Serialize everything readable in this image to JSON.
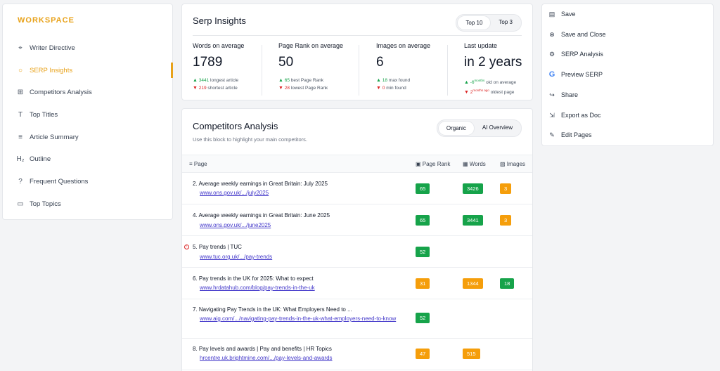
{
  "sidebar": {
    "title": "WORKSPACE",
    "items": [
      {
        "label": "Writer Directive",
        "icon": "⌖"
      },
      {
        "label": "SERP Insights",
        "icon": "💡"
      },
      {
        "label": "Competitors Analysis",
        "icon": "⊞"
      },
      {
        "label": "Top Titles",
        "icon": "T"
      },
      {
        "label": "Article Summary",
        "icon": "≡"
      },
      {
        "label": "Outline",
        "icon": "H₂"
      },
      {
        "label": "Frequent Questions",
        "icon": "?"
      },
      {
        "label": "Top Topics",
        "icon": "▭"
      }
    ]
  },
  "serp": {
    "title": "Serp Insights",
    "toggle": [
      "Top 10",
      "Top 3"
    ],
    "stats": [
      {
        "label": "Words on average",
        "value": "1789",
        "up_num": "3441",
        "up_text": "longest article",
        "down_num": "219",
        "down_text": "shortest article"
      },
      {
        "label": "Page Rank on average",
        "value": "50",
        "up_num": "65",
        "up_text": "best Page Rank",
        "down_num": "28",
        "down_text": "lowest Page Rank"
      },
      {
        "label": "Images on average",
        "value": "6",
        "up_num": "18",
        "up_text": "max found",
        "down_num": "0",
        "down_text": "min found"
      },
      {
        "label": "Last update",
        "value": "in 2 years",
        "up_num": "-6",
        "up_unit": "months",
        "up_text": "old on average",
        "down_num": "2",
        "down_unit": "months ago",
        "down_text": "oldest page"
      }
    ]
  },
  "competitors": {
    "title": "Competitors Analysis",
    "description": "Use this block to highlight your main competitors.",
    "toggle": [
      "Organic",
      "AI Overview"
    ],
    "columns": [
      "Page",
      "Page Rank",
      "Words",
      "Images"
    ],
    "rows": [
      {
        "title": "2.  Average weekly earnings in Great Britain: July 2025",
        "url": "www.ons.gov.uk/.../july2025",
        "rank": "65",
        "words": "3426",
        "images": "3"
      },
      {
        "title": "4.  Average weekly earnings in Great Britain: June 2025",
        "url": "www.ons.gov.uk/.../june2025",
        "rank": "65",
        "words": "3441",
        "images": "3"
      },
      {
        "title": "5.  Pay trends | TUC",
        "url": "www.tuc.org.uk/.../pay-trends",
        "rank": "52",
        "words": "",
        "images": ""
      },
      {
        "title": "6.  Pay trends in the UK for 2025: What to expect",
        "url": "www.hrdatahub.com/blog/pay-trends-in-the-uk",
        "rank": "31",
        "words": "1344",
        "images": "18"
      },
      {
        "title": "7.  Navigating Pay Trends in the UK: What Employers Need to ...",
        "url": "www.aig.com/.../navigating-pay-trends-in-the-uk-what-employers-need-to-know",
        "rank": "52",
        "words": "",
        "images": ""
      },
      {
        "title": "8.  Pay levels and awards | Pay and benefits | HR Topics",
        "url": "hrcentre.uk.brightmine.com/.../pay-levels-and-awards",
        "rank": "47",
        "words": "515",
        "images": ""
      }
    ]
  },
  "actions": [
    {
      "label": "Save",
      "icon": "▤"
    },
    {
      "label": "Save and Close",
      "icon": "⊗"
    },
    {
      "label": "SERP Analysis",
      "icon": "⚙"
    },
    {
      "label": "Preview SERP",
      "icon": "G"
    },
    {
      "label": "Share",
      "icon": "↪"
    },
    {
      "label": "Export as Doc",
      "icon": "⇲"
    },
    {
      "label": "Edit Pages",
      "icon": "✎"
    }
  ]
}
